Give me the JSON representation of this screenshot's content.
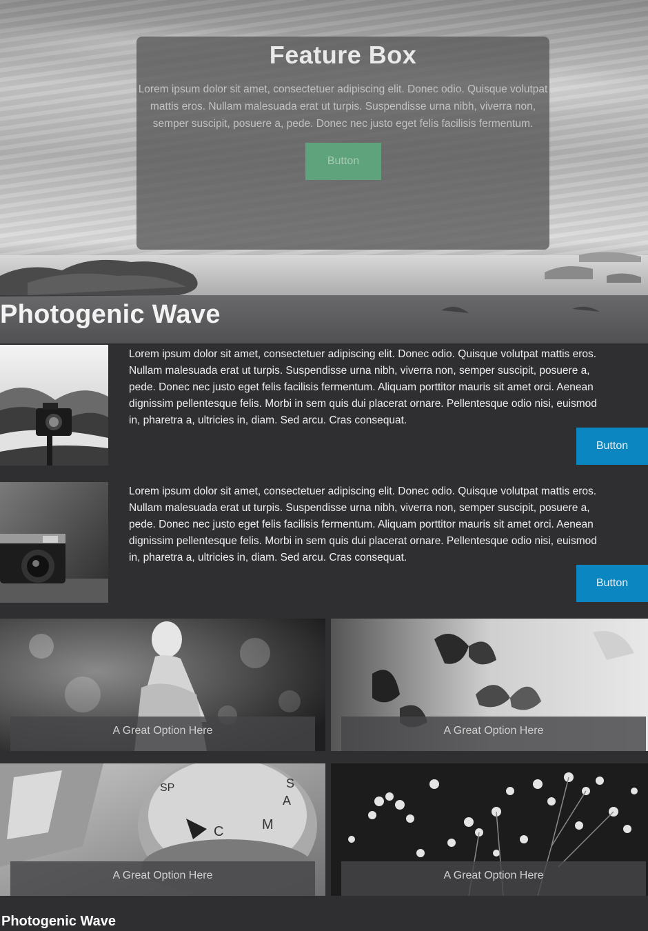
{
  "hero": {
    "feature_title": "Feature Box",
    "feature_text": "Lorem ipsum dolor sit amet, consectetuer adipiscing elit. Donec odio. Quisque volutpat mattis eros. Nullam malesuada erat ut turpis. Suspendisse urna nibh, viverra non, semper suscipit, posuere a, pede. Donec nec justo eget felis facilisis fermentum.",
    "button_label": "Button",
    "button_color": "#5fa37d"
  },
  "section": {
    "title": "Photogenic Wave"
  },
  "articles": [
    {
      "image": "camera-on-tripod-lake-photo",
      "text": "Lorem ipsum dolor sit amet, consectetuer adipiscing elit. Donec odio. Quisque volutpat mattis eros. Nullam malesuada erat ut turpis. Suspendisse urna nibh, viverra non, semper suscipit, posuere a, pede. Donec nec justo eget felis facilisis fermentum. Aliquam porttitor mauris sit amet orci. Aenean dignissim pellentesque felis. Morbi in sem quis dui placerat ornare. Pellentesque odio nisi, euismod in, pharetra a, ultricies in, diam. Sed arcu. Cras consequat.",
      "button_label": "Button"
    },
    {
      "image": "vintage-camera-photo",
      "text": "Lorem ipsum dolor sit amet, consectetuer adipiscing elit. Donec odio. Quisque volutpat mattis eros. Nullam malesuada erat ut turpis. Suspendisse urna nibh, viverra non, semper suscipit, posuere a, pede. Donec nec justo eget felis facilisis fermentum. Aliquam porttitor mauris sit amet orci. Aenean dignissim pellentesque felis. Morbi in sem quis dui placerat ornare. Pellentesque odio nisi, euismod in, pharetra a, ultricies in, diam. Sed arcu. Cras consequat.",
      "button_label": "Button"
    }
  ],
  "accent_color": "#0b86c0",
  "tiles": [
    {
      "image": "porcelain-figurine-photo",
      "caption": "A Great Option Here"
    },
    {
      "image": "butterflies-photo",
      "caption": "A Great Option Here"
    },
    {
      "image": "camera-mode-dial-photo",
      "caption": "A Great Option Here"
    },
    {
      "image": "babys-breath-flowers-photo",
      "caption": "A Great Option Here"
    }
  ],
  "footer": {
    "title": "Photogenic Wave"
  }
}
